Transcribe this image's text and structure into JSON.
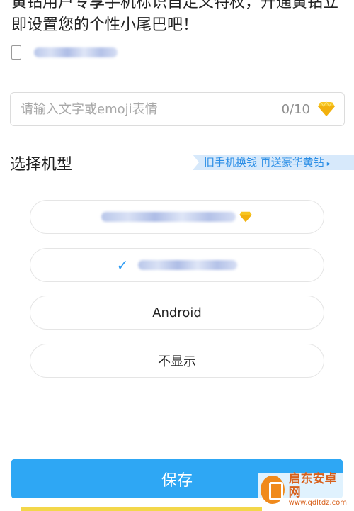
{
  "intro": {
    "line1": "黄钻用户专享手机标识自定义特权，开通黄钻立",
    "line2": "即设置您的个性小尾巴吧！"
  },
  "tail_input": {
    "placeholder": "请输入文字或emoji表情",
    "value": "",
    "counter": "0/10"
  },
  "section": {
    "title": "选择机型",
    "promo": "旧手机换钱 再送豪华黄钻"
  },
  "options": [
    {
      "label": "",
      "selected": false,
      "blurred": true
    },
    {
      "label": "",
      "selected": true,
      "blurred": true
    },
    {
      "label": "Android",
      "selected": false,
      "blurred": false
    },
    {
      "label": "不显示",
      "selected": false,
      "blurred": false
    }
  ],
  "save": {
    "label": "保存"
  },
  "watermark": {
    "name": "启东安卓网",
    "url": "www.qdltdz.com"
  },
  "colors": {
    "accent": "#2ea7f4",
    "check": "#2b9af3",
    "diamond": "#f7c520",
    "promo_bg": "#d7e9fb",
    "promo_text": "#2b8ee6"
  }
}
